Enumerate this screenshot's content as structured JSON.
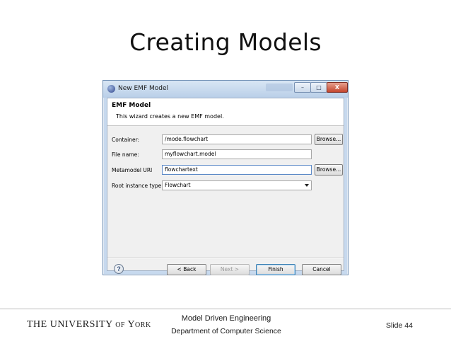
{
  "slide": {
    "title": "Creating Models",
    "footer": {
      "university_logo": "THE UNIVERSITY of York",
      "course": "Model Driven Engineering",
      "department": "Department of Computer Science",
      "slide_number": "Slide 44"
    }
  },
  "dialog": {
    "window_title": "New EMF Model",
    "window_buttons": {
      "minimize": "–",
      "maximize": "□",
      "close": "X"
    },
    "header": {
      "title": "EMF Model",
      "description": "This wizard creates a new EMF model."
    },
    "fields": [
      {
        "label": "Container:",
        "value": "/mode.flowchart",
        "has_browse": true
      },
      {
        "label": "File name:",
        "value": "myflowchart.model",
        "has_browse": false
      },
      {
        "label": "Metamodel URI",
        "value": "flowchartext",
        "has_browse": true
      },
      {
        "label": "Root instance type",
        "value": "Flowchart",
        "has_browse": false,
        "is_combo": true
      }
    ],
    "browse_label": "Browse...",
    "footer_buttons": {
      "help": "?",
      "back": "< Back",
      "next": "Next >",
      "finish": "Finish",
      "cancel": "Cancel"
    }
  },
  "icons": {
    "window_icon": "eclipse-icon",
    "help": "help-icon",
    "combo_arrow": "chevron-down-icon"
  },
  "colors": {
    "window_frame": "#c7d9ee",
    "close_button": "#c4452d",
    "default_button_border": "#3c7fb1"
  }
}
